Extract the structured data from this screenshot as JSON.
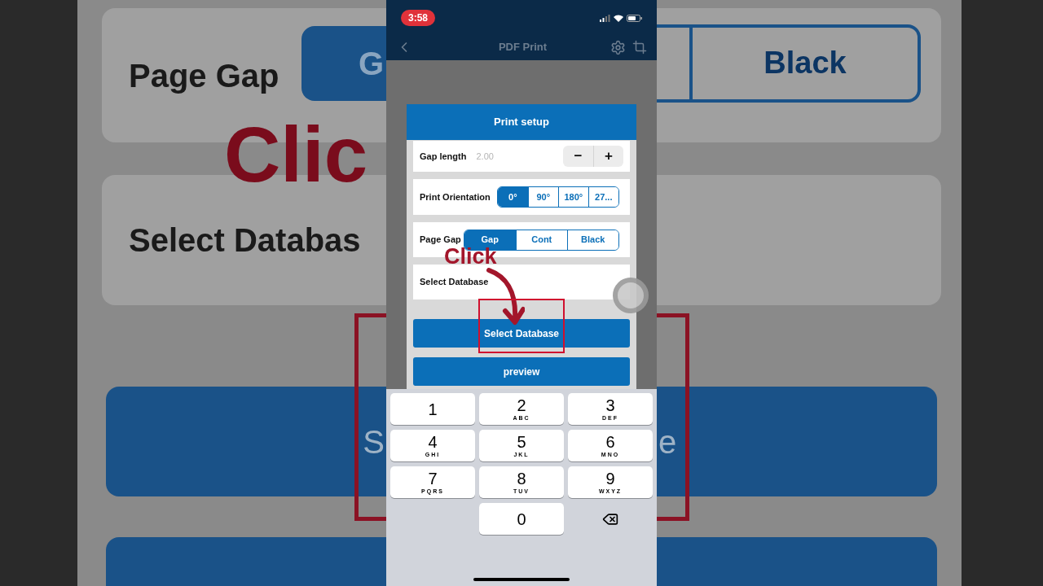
{
  "background": {
    "left": {
      "title": "Page Gap",
      "segment_letter": "G",
      "annotation": "Clic",
      "label": "Select Databas",
      "button_letter": "S"
    },
    "right": {
      "segment_label": "Black",
      "button_letter": "e"
    }
  },
  "status_bar": {
    "time": "3:58"
  },
  "nav": {
    "title": "PDF Print"
  },
  "dialog": {
    "title": "Print setup",
    "gap_length": {
      "label": "Gap length",
      "placeholder": "2.00",
      "buttons": [
        "−",
        "+"
      ]
    },
    "orientation": {
      "label": "Print Orientation",
      "options": [
        {
          "label": "0°",
          "selected": true
        },
        {
          "label": "90°",
          "selected": false
        },
        {
          "label": "180°",
          "selected": false
        },
        {
          "label": "27...",
          "selected": false
        }
      ]
    },
    "page_gap": {
      "label": "Page Gap",
      "options": [
        {
          "label": "Gap",
          "selected": true
        },
        {
          "label": "Cont",
          "selected": false
        },
        {
          "label": "Black",
          "selected": false
        }
      ]
    },
    "database": {
      "label": "Select Database"
    },
    "buttons": [
      "Select Database",
      "preview"
    ]
  },
  "annotation": {
    "text": "Click"
  },
  "keypad": {
    "keys": [
      {
        "kind": "digit",
        "digit": "1"
      },
      {
        "kind": "digit",
        "digit": "2",
        "letters": "ABC"
      },
      {
        "kind": "digit",
        "digit": "3",
        "letters": "DEF"
      },
      {
        "kind": "digit",
        "digit": "4",
        "letters": "GHI"
      },
      {
        "kind": "digit",
        "digit": "5",
        "letters": "JKL"
      },
      {
        "kind": "digit",
        "digit": "6",
        "letters": "MNO"
      },
      {
        "kind": "digit",
        "digit": "7",
        "letters": "PQRS"
      },
      {
        "kind": "digit",
        "digit": "8",
        "letters": "TUV"
      },
      {
        "kind": "digit",
        "digit": "9",
        "letters": "WXYZ"
      },
      {
        "kind": "blank"
      },
      {
        "kind": "digit",
        "digit": "0"
      },
      {
        "kind": "backspace"
      }
    ]
  }
}
